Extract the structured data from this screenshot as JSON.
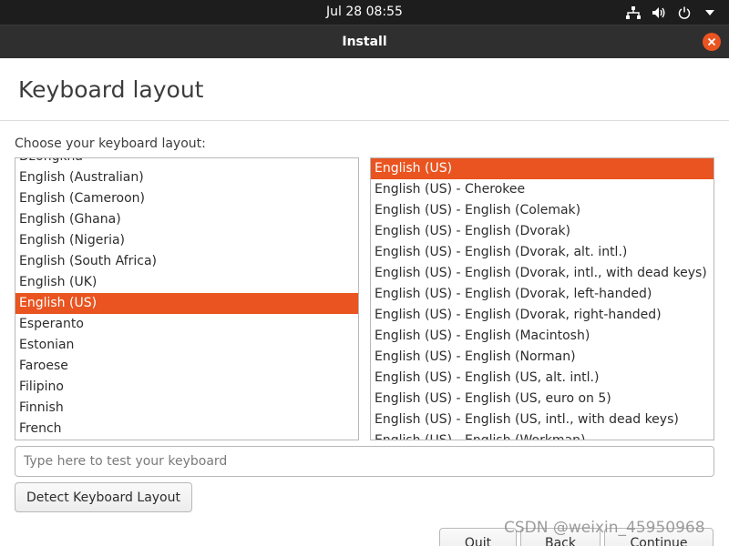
{
  "topbar": {
    "clock": "Jul 28  08:55",
    "icons": [
      "network-icon",
      "volume-icon",
      "power-icon",
      "menu-arrow-icon"
    ]
  },
  "window": {
    "title": "Install",
    "close_color": "#e95420"
  },
  "page": {
    "title": "Keyboard layout",
    "choose_label": "Choose your keyboard layout:"
  },
  "layouts": {
    "selected": "English (US)",
    "items": [
      "Dzongkha",
      "English (Australian)",
      "English (Cameroon)",
      "English (Ghana)",
      "English (Nigeria)",
      "English (South Africa)",
      "English (UK)",
      "English (US)",
      "Esperanto",
      "Estonian",
      "Faroese",
      "Filipino",
      "Finnish",
      "French"
    ]
  },
  "variants": {
    "selected": "English (US)",
    "items": [
      "English (US)",
      "English (US) - Cherokee",
      "English (US) - English (Colemak)",
      "English (US) - English (Dvorak)",
      "English (US) - English (Dvorak, alt. intl.)",
      "English (US) - English (Dvorak, intl., with dead keys)",
      "English (US) - English (Dvorak, left-handed)",
      "English (US) - English (Dvorak, right-handed)",
      "English (US) - English (Macintosh)",
      "English (US) - English (Norman)",
      "English (US) - English (US, alt. intl.)",
      "English (US) - English (US, euro on 5)",
      "English (US) - English (US, intl., with dead keys)",
      "English (US) - English (Workman)"
    ]
  },
  "test_input": {
    "placeholder": "Type here to test your keyboard",
    "value": ""
  },
  "buttons": {
    "detect": "Detect Keyboard Layout",
    "quit": "Quit",
    "back": "Back",
    "continue": "Continue"
  },
  "watermark": "CSDN @weixin_45950968",
  "colors": {
    "accent": "#e95420",
    "topbar": "#1d1d1d",
    "titlebar": "#2f2f2f"
  }
}
